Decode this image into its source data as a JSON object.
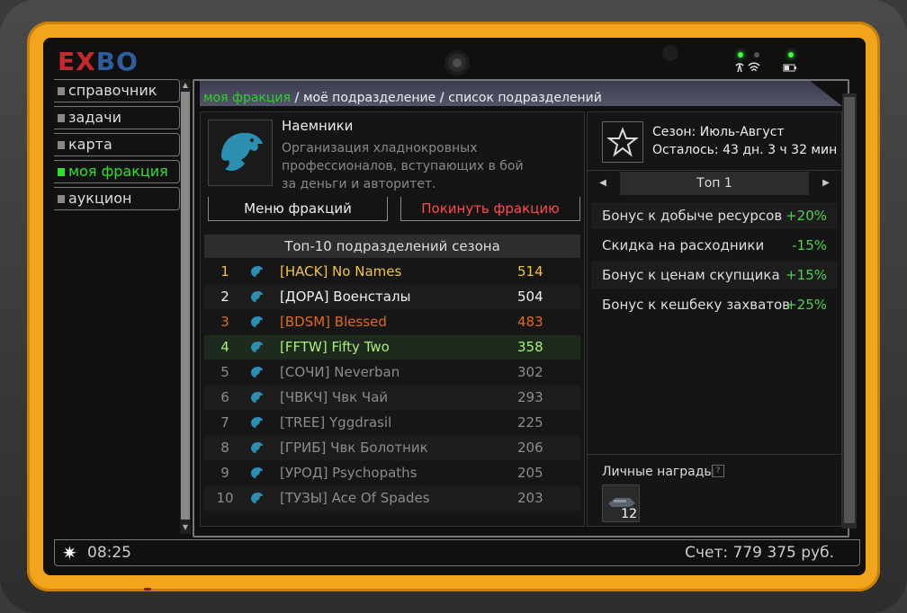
{
  "device": {
    "logo": {
      "left": "E",
      "mid": "X",
      "right": "BO"
    }
  },
  "nav": {
    "items": [
      {
        "label": "справочник",
        "active": false
      },
      {
        "label": "задачи",
        "active": false
      },
      {
        "label": "карта",
        "active": false
      },
      {
        "label": "моя фракция",
        "active": true
      },
      {
        "label": "аукцион",
        "active": false
      }
    ]
  },
  "breadcrumb": {
    "current": "моя фракция",
    "sep": "/",
    "second": "моё подразделение",
    "third": "список подразделений"
  },
  "faction": {
    "name": "Наемники",
    "description_line1": "Организация хладнокровных",
    "description_line2": "профессионалов, вступающих в бой",
    "description_line3": "за деньги и авторитет.",
    "menu_button": "Меню фракций",
    "leave_button": "Покинуть фракцию",
    "table_title": "Топ-10 подразделений сезона",
    "rows": [
      {
        "rank": "1",
        "name": "[HACK] No Names",
        "score": "514",
        "color": "#f2c33b"
      },
      {
        "rank": "2",
        "name": "[ДОРА] Военсталы",
        "score": "504",
        "color": "#f0f0f0"
      },
      {
        "rank": "3",
        "name": "[BDSM] Blessed",
        "score": "483",
        "color": "#e06a1e"
      },
      {
        "rank": "4",
        "name": "[FFTW] Fifty Two",
        "score": "358",
        "color": "#a7f07a"
      },
      {
        "rank": "5",
        "name": "[СОЧИ] Neverban",
        "score": "302",
        "color": "#8c8c8c"
      },
      {
        "rank": "6",
        "name": "[ЧВКЧ] Чвк Чай",
        "score": "293",
        "color": "#8c8c8c"
      },
      {
        "rank": "7",
        "name": "[TREE] Yggdrasil",
        "score": "225",
        "color": "#8c8c8c"
      },
      {
        "rank": "8",
        "name": "[ГРИБ] Чвк Болотник",
        "score": "206",
        "color": "#8c8c8c"
      },
      {
        "rank": "9",
        "name": "[УРОД] Psychopaths",
        "score": "205",
        "color": "#8c8c8c"
      },
      {
        "rank": "10",
        "name": "[ТУЗЫ] Ace Of Spades",
        "score": "203",
        "color": "#8c8c8c"
      }
    ]
  },
  "season": {
    "title": "Сезон: Июль-Август",
    "remaining": "Осталось: 43 дн. 3 ч 32 мин",
    "top_label": "Топ 1",
    "bonuses": [
      {
        "label": "Бонус к добыче ресурсов",
        "value": "+20%"
      },
      {
        "label": "Скидка на расходники",
        "value": "-15%"
      },
      {
        "label": "Бонус к ценам скупщика",
        "value": "+15%"
      },
      {
        "label": "Бонус к кешбеку захватов",
        "value": "+25%"
      }
    ],
    "awards_title": "Личные награды",
    "awards_help": "?",
    "award_count": "12"
  },
  "status": {
    "time": "08:25",
    "balance": "Счет: 779 375 руб."
  },
  "colors": {
    "accent_green": "#2ee02e",
    "bezel": "#f2a51c",
    "leave_red": "#ff4a4a"
  }
}
